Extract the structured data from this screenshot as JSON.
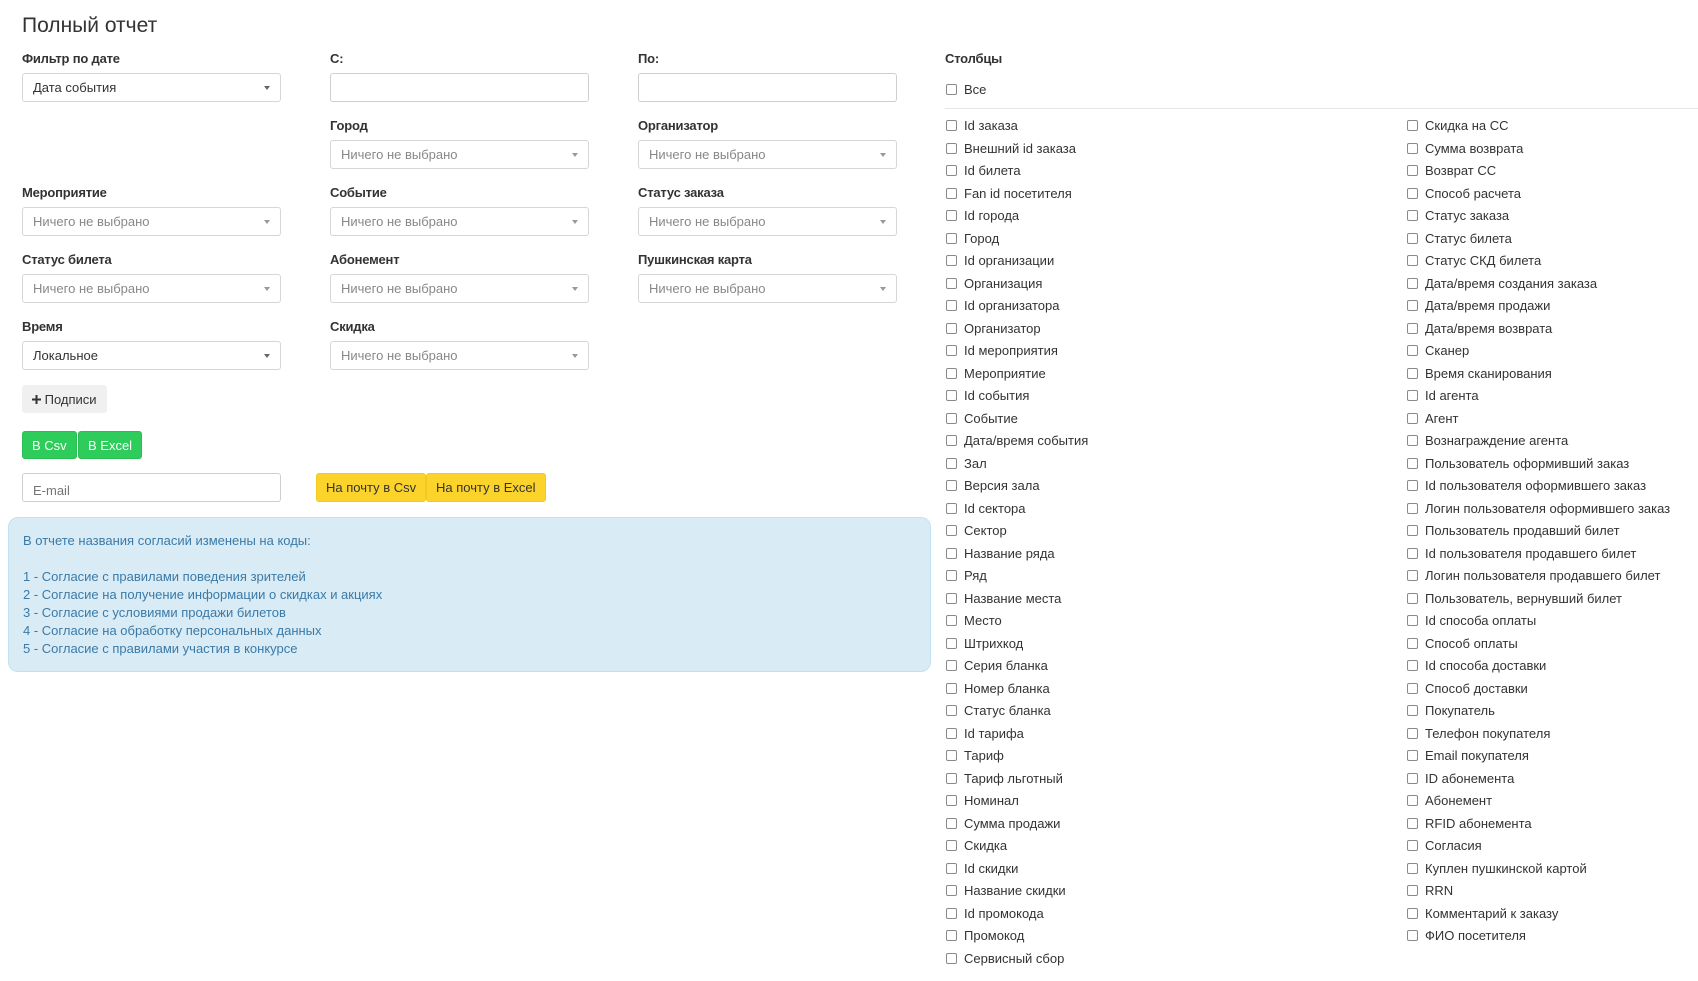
{
  "page_title": "Полный отчет",
  "filters": {
    "date_filter": {
      "label": "Фильтр по дате",
      "value": "Дата события"
    },
    "from": {
      "label": "С:",
      "value": ""
    },
    "to": {
      "label": "По:",
      "value": ""
    },
    "city": {
      "label": "Город",
      "placeholder": "Ничего не выбрано"
    },
    "organizer": {
      "label": "Организатор",
      "placeholder": "Ничего не выбрано"
    },
    "event_group": {
      "label": "Мероприятие",
      "placeholder": "Ничего не выбрано"
    },
    "event": {
      "label": "Событие",
      "placeholder": "Ничего не выбрано"
    },
    "order_status": {
      "label": "Статус заказа",
      "placeholder": "Ничего не выбрано"
    },
    "ticket_status": {
      "label": "Статус билета",
      "placeholder": "Ничего не выбрано"
    },
    "subscription": {
      "label": "Абонемент",
      "placeholder": "Ничего не выбрано"
    },
    "pushkin_card": {
      "label": "Пушкинская карта",
      "placeholder": "Ничего не выбрано"
    },
    "time": {
      "label": "Время",
      "value": "Локальное"
    },
    "discount": {
      "label": "Скидка",
      "placeholder": "Ничего не выбрано"
    }
  },
  "buttons": {
    "captions": "Подписи",
    "captions_icon": "plus-icon",
    "to_csv": "В Csv",
    "to_excel": "В Excel",
    "mail_csv": "На почту в Csv",
    "mail_excel": "На почту в Excel"
  },
  "email": {
    "placeholder": "E-mail",
    "value": ""
  },
  "info": {
    "header": "В отчете названия согласий изменены на коды:",
    "lines": [
      "1 - Согласие с правилами поведения зрителей",
      "2 - Согласие на получение информации о скидках и акциях",
      "3 - Согласие с условиями продажи билетов",
      "4 - Согласие на обработку персональных данных",
      "5 - Согласие с правилами участия в конкурсе"
    ]
  },
  "columns": {
    "title": "Столбцы",
    "all_label": "Все",
    "left": [
      "Id заказа",
      "Внешний id заказа",
      "Id билета",
      "Fan id посетителя",
      "Id города",
      "Город",
      "Id организации",
      "Организация",
      "Id организатора",
      "Организатор",
      "Id мероприятия",
      "Мероприятие",
      "Id события",
      "Событие",
      "Дата/время события",
      "Зал",
      "Версия зала",
      "Id сектора",
      "Сектор",
      "Название ряда",
      "Ряд",
      "Название места",
      "Место",
      "Штрихкод",
      "Серия бланка",
      "Номер бланка",
      "Статус бланка",
      "Id тарифа",
      "Тариф",
      "Тариф льготный",
      "Номинал",
      "Сумма продажи",
      "Скидка",
      "Id скидки",
      "Название скидки",
      "Id промокода",
      "Промокод",
      "Сервисный сбор"
    ],
    "right": [
      "Скидка на СС",
      "Сумма возврата",
      "Возврат СС",
      "Способ расчета",
      "Статус заказа",
      "Статус билета",
      "Статус СКД билета",
      "Дата/время создания заказа",
      "Дата/время продажи",
      "Дата/время возврата",
      "Сканер",
      "Время сканирования",
      "Id агента",
      "Агент",
      "Вознаграждение агента",
      "Пользователь оформивший заказ",
      "Id пользователя оформившего заказ",
      "Логин пользователя оформившего заказ",
      "Пользователь продавший билет",
      "Id пользователя продавшего билет",
      "Логин пользователя продавшего билет",
      "Пользователь, вернувший билет",
      "Id способа оплаты",
      "Способ оплаты",
      "Id способа доставки",
      "Способ доставки",
      "Покупатель",
      "Телефон покупателя",
      "Email покупателя",
      "ID абонемента",
      "Абонемент",
      "RFID абонемента",
      "Согласия",
      "Куплен пушкинской картой",
      "RRN",
      "Комментарий к заказу",
      "ФИО посетителя"
    ]
  },
  "colors": {
    "green": "#2ecc5a",
    "yellow": "#fbd32a",
    "info_bg": "#d9ecf5",
    "info_text": "#3a7aa8"
  }
}
